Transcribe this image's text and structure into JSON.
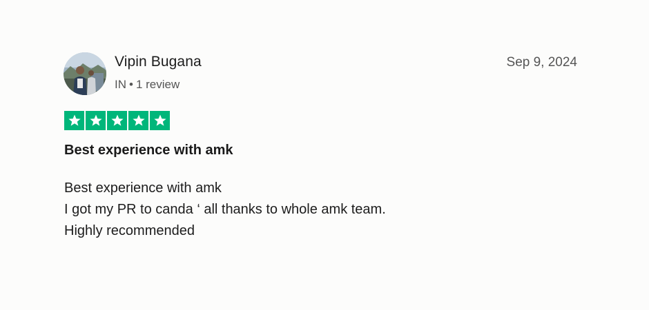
{
  "review": {
    "reviewer": {
      "name": "Vipin Bugana",
      "country": "IN",
      "separator": "•",
      "review_count": "1 review",
      "avatar_icon": "user-photo-avatar"
    },
    "date": "Sep 9, 2024",
    "rating": {
      "stars": 5,
      "max_stars": 5,
      "color": "#00b67a",
      "icon": "star-icon"
    },
    "title": "Best experience with amk",
    "body_lines": [
      "Best experience with amk",
      "I got my PR to canda ‘ all thanks to whole amk team.",
      "Highly recommended"
    ]
  }
}
